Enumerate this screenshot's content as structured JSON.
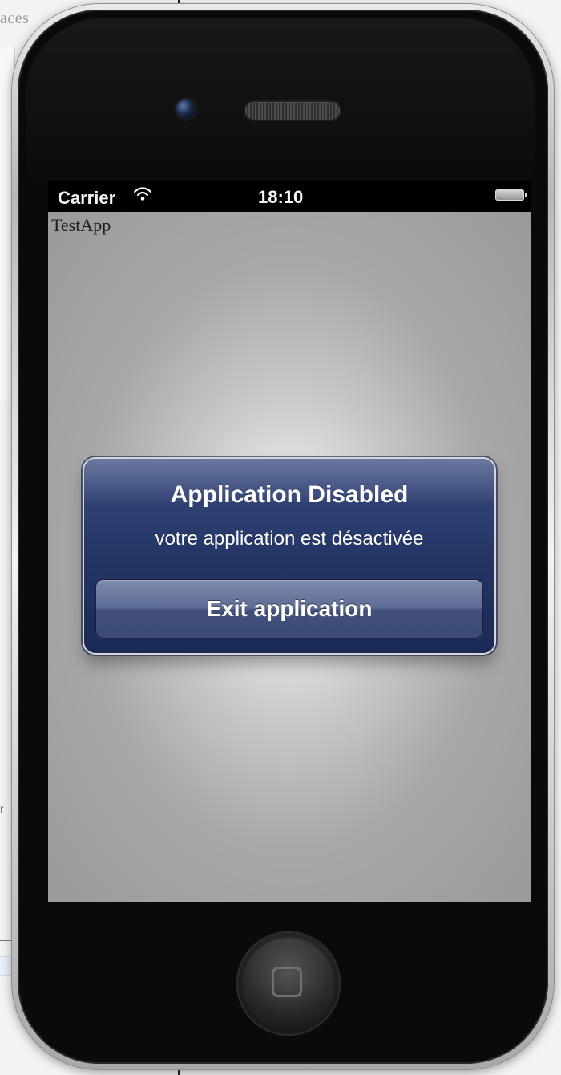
{
  "background": {
    "partial_text": "aces",
    "fragment_letter": "r"
  },
  "device": {
    "camera_icon": "front-camera-icon",
    "speaker_icon": "earpiece-icon",
    "home_button_icon": "home-square-icon"
  },
  "status_bar": {
    "carrier": "Carrier",
    "time": "18:10",
    "wifi_icon": "wifi-icon",
    "battery_icon": "battery-icon"
  },
  "app": {
    "title": "TestApp"
  },
  "alert": {
    "title": "Application Disabled",
    "message": "votre application est désactivée",
    "button_label": "Exit application"
  },
  "colors": {
    "alert_blue": "#243566",
    "button_blue": "#5d6c95",
    "screen_gray": "#a8a8a8",
    "status_black": "#000000"
  }
}
